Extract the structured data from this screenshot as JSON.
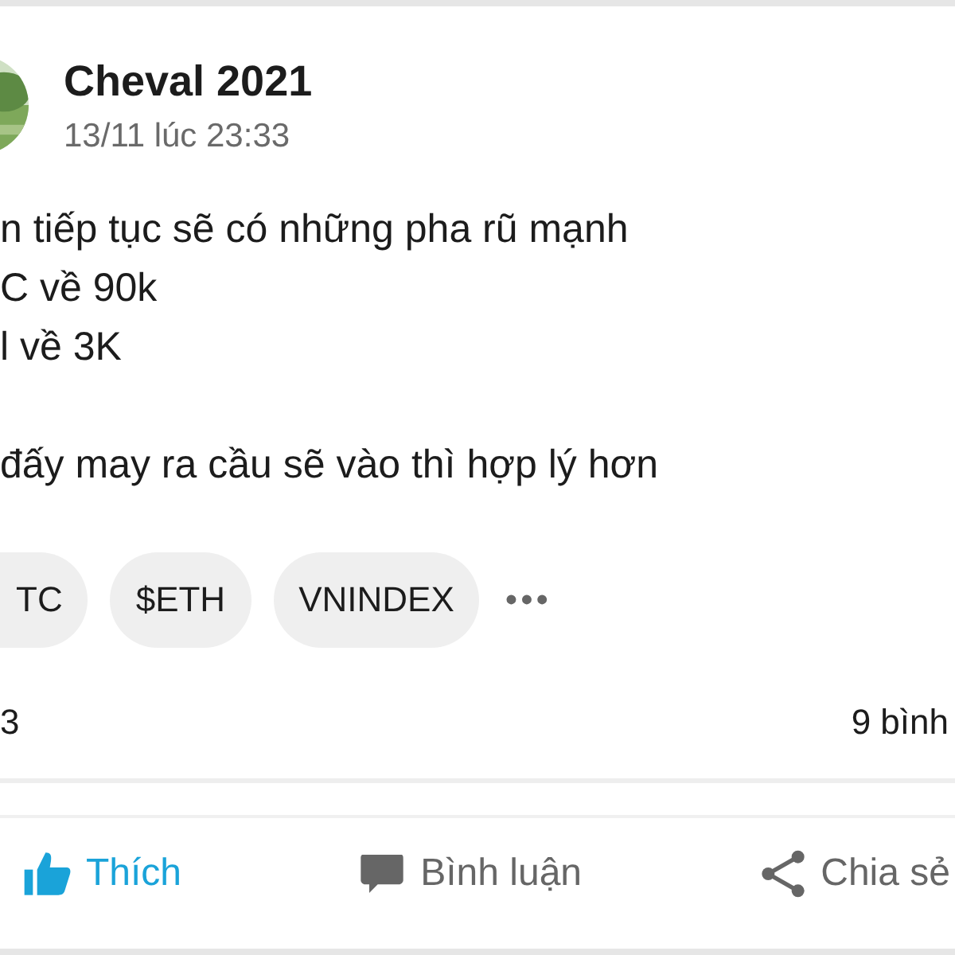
{
  "post": {
    "author": "Cheval 2021",
    "time": "13/11 lúc 23:33",
    "paragraphs": [
      [
        "n tiếp tục sẽ có những pha rũ mạnh",
        "C về 90k",
        "l về 3K"
      ],
      [
        "đấy may ra cầu sẽ vào thì hợp lý hơn"
      ]
    ],
    "tags": [
      "TC",
      "$ETH",
      "VNINDEX"
    ],
    "more": "•••",
    "stats": {
      "reactions": "3",
      "comments": "9 bình"
    }
  },
  "actions": [
    {
      "kind": "like",
      "label": "Thích",
      "selected": true
    },
    {
      "kind": "comment",
      "label": "Bình luận",
      "selected": false
    },
    {
      "kind": "share",
      "label": "Chia sẻ",
      "selected": false
    }
  ]
}
